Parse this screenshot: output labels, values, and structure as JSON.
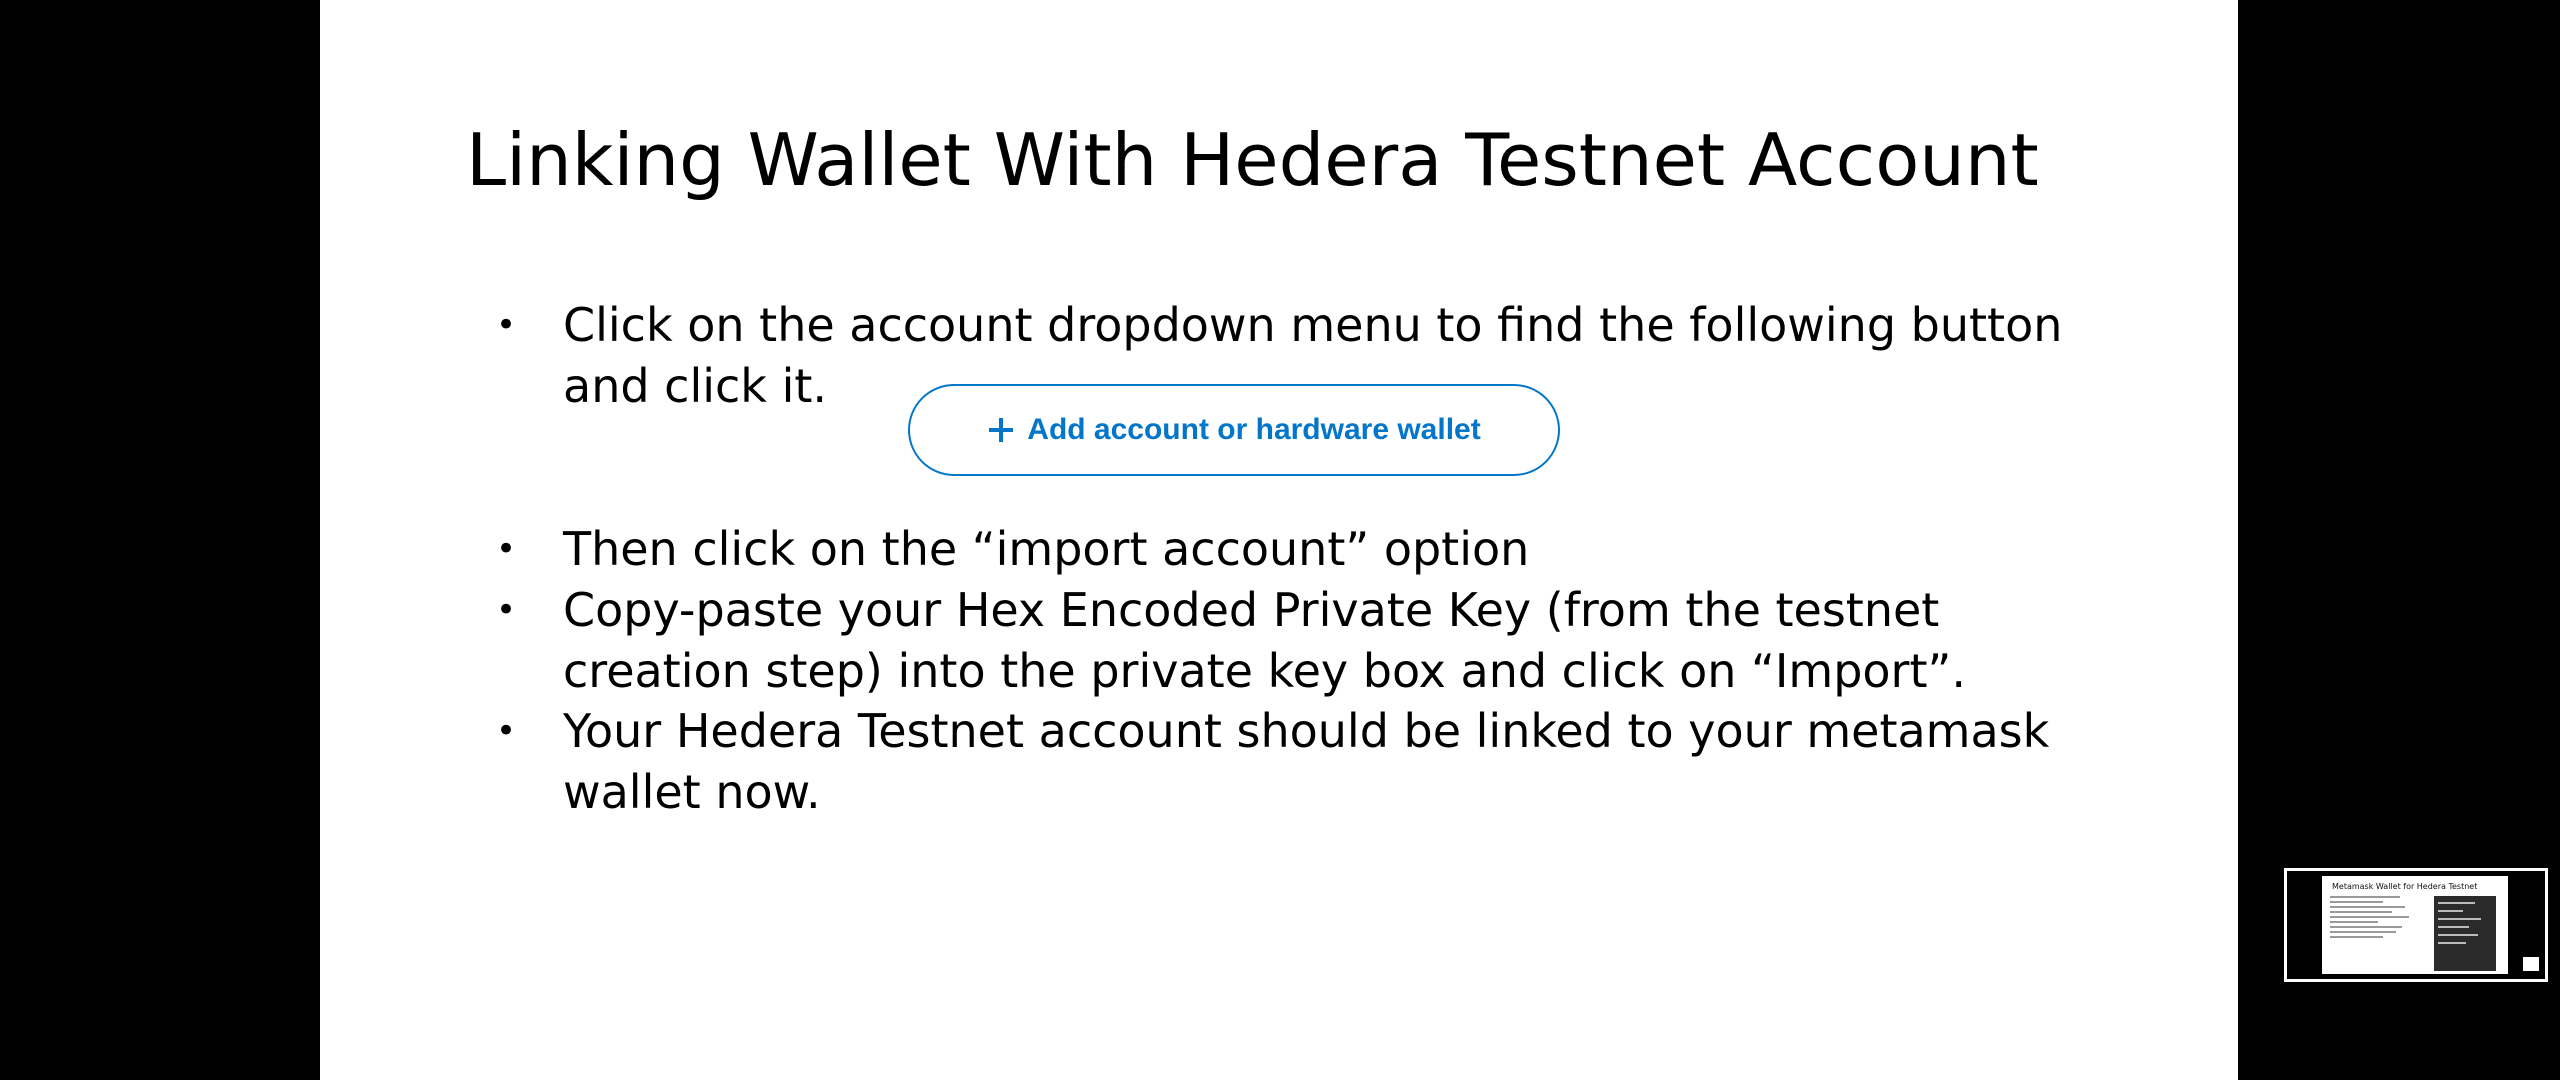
{
  "slide": {
    "title": "Linking Wallet With Hedera Testnet Account",
    "bullet_symbol": "•",
    "bullets": [
      {
        "lines": [
          "Click on the account dropdown menu to find the following button",
          "and click it."
        ]
      },
      {
        "lines": [
          "Then click on the “import account” option"
        ]
      },
      {
        "lines": [
          "Copy-paste your Hex Encoded Private Key (from the testnet",
          "creation step) into the private key box and click on “Import”."
        ]
      },
      {
        "lines": [
          "Your Hedera Testnet account should be linked to your metamask",
          "wallet now."
        ]
      }
    ],
    "embedded_button": {
      "label": "Add account or hardware wallet",
      "icon": "plus-icon",
      "color": "#0376c9"
    }
  },
  "thumbnail": {
    "title": "Metamask Wallet for Hedera Testnet"
  },
  "colors": {
    "background": "#000000",
    "slide": "#ffffff",
    "text": "#000000",
    "accent": "#0376c9"
  }
}
